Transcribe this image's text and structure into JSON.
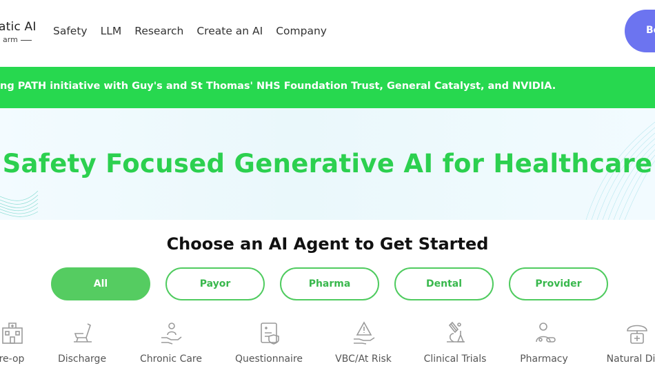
{
  "header": {
    "logo_text": "atic AI",
    "logo_sub": "arm",
    "nav": [
      {
        "label": "Safety"
      },
      {
        "label": "LLM"
      },
      {
        "label": "Research"
      },
      {
        "label": "Create an AI"
      },
      {
        "label": "Company"
      }
    ],
    "cta_label": "Bo"
  },
  "banner": {
    "text": "ng PATH initiative with Guy's and St Thomas' NHS Foundation Trust, General Catalyst, and NVIDIA."
  },
  "hero": {
    "title": "Safety Focused Generative AI for Healthcare"
  },
  "choose": {
    "title": "Choose an AI Agent to Get Started",
    "filters": [
      {
        "label": "All",
        "active": true
      },
      {
        "label": "Payor",
        "active": false
      },
      {
        "label": "Pharma",
        "active": false
      },
      {
        "label": "Dental",
        "active": false
      },
      {
        "label": "Provider",
        "active": false
      }
    ]
  },
  "agents": [
    {
      "label": "re-op",
      "icon": "hospital-icon"
    },
    {
      "label": "Discharge",
      "icon": "wheelchair-icon"
    },
    {
      "label": "Chronic Care",
      "icon": "care-hand-icon"
    },
    {
      "label": "Questionnaire",
      "icon": "clipboard-shield-icon"
    },
    {
      "label": "VBC/At Risk",
      "icon": "warning-hand-icon"
    },
    {
      "label": "Clinical Trials",
      "icon": "microscope-icon"
    },
    {
      "label": "Pharmacy",
      "icon": "pharmacist-icon"
    },
    {
      "label": "Natural Disa",
      "icon": "first-aid-umbrella-icon"
    }
  ],
  "colors": {
    "brand_green": "#2cd04f",
    "banner_green": "#27d84f",
    "pill_green": "#55cc61",
    "cta_blue": "#6c74f0"
  }
}
